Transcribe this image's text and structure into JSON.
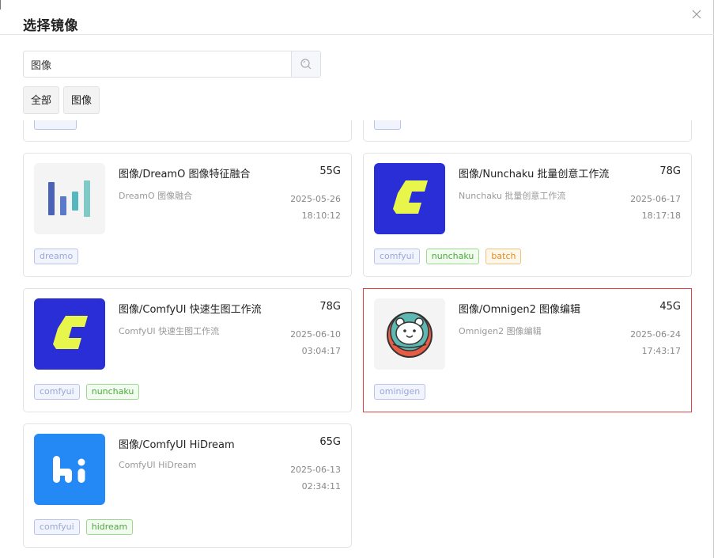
{
  "dialog": {
    "title": "选择镜像",
    "close_icon": "close-icon"
  },
  "search": {
    "value": "图像",
    "placeholder": "",
    "icon": "search-icon"
  },
  "filters": [
    {
      "label": "全部"
    },
    {
      "label": "图像"
    }
  ],
  "cards": [
    {
      "name": "图像/DreamO 图像特征融合",
      "size": "55G",
      "description": "DreamO 图像融合",
      "date": "2025-05-26",
      "time": "18:10:12",
      "icon": "dreamo-logo-icon",
      "tags": [
        {
          "label": "dreamo",
          "color": "blue"
        }
      ]
    },
    {
      "name": "图像/Nunchaku 批量创意工作流",
      "size": "78G",
      "description": "Nunchaku 批量创意工作流",
      "date": "2025-06-17",
      "time": "18:17:18",
      "icon": "comfyui-logo-icon",
      "tags": [
        {
          "label": "comfyui",
          "color": "blue"
        },
        {
          "label": "nunchaku",
          "color": "green"
        },
        {
          "label": "batch",
          "color": "orange"
        }
      ]
    },
    {
      "name": "图像/ComfyUI 快速生图工作流",
      "size": "78G",
      "description": "ComfyUI 快速生图工作流",
      "date": "2025-06-10",
      "time": "03:04:17",
      "icon": "comfyui-logo-icon",
      "tags": [
        {
          "label": "comfyui",
          "color": "blue"
        },
        {
          "label": "nunchaku",
          "color": "green"
        }
      ]
    },
    {
      "name": "图像/Omnigen2 图像编辑",
      "size": "45G",
      "description": "Omnigen2 图像编辑",
      "date": "2025-06-24",
      "time": "17:43:17",
      "icon": "bear-astronaut-icon",
      "selected": true,
      "tags": [
        {
          "label": "ominigen",
          "color": "blue"
        }
      ]
    },
    {
      "name": "图像/ComfyUI HiDream",
      "size": "65G",
      "description": "ComfyUI HiDream",
      "date": "2025-06-13",
      "time": "02:34:11",
      "icon": "hidream-logo-icon",
      "tags": [
        {
          "label": "comfyui",
          "color": "blue"
        },
        {
          "label": "hidream",
          "color": "green"
        }
      ]
    }
  ],
  "colors": {
    "selected_border": "#e04545",
    "tag_blue": "#9aa8d8",
    "tag_green": "#4caa3c",
    "tag_orange": "#e58c1b",
    "comfy_blue": "#2a2ed6",
    "comfy_yellow": "#e8f54a",
    "hidream_blue": "#2589f5"
  }
}
